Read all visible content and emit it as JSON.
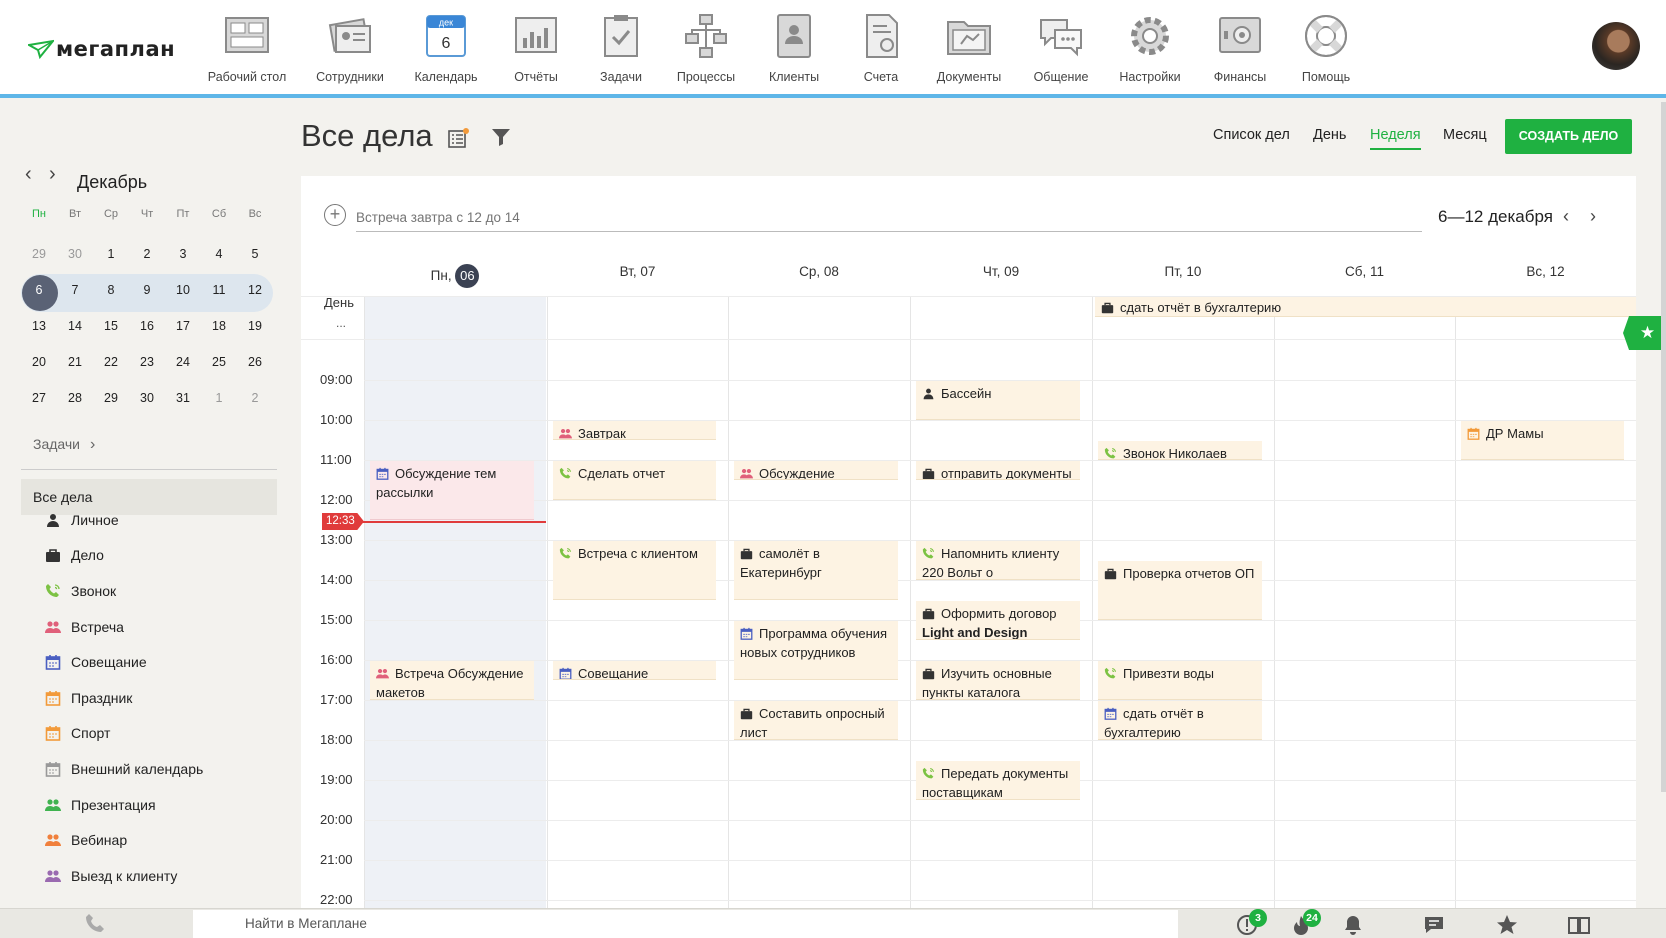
{
  "app": {
    "brand": "мегаплан"
  },
  "nav": [
    {
      "label": "Рабочий стол",
      "icon": "desktop-icon"
    },
    {
      "label": "Сотрудники",
      "icon": "employees-icon"
    },
    {
      "label": "Календарь",
      "icon": "calendar-icon",
      "badge_month": "дек",
      "badge_day": "6"
    },
    {
      "label": "Отчёты",
      "icon": "reports-icon"
    },
    {
      "label": "Задачи",
      "icon": "tasks-icon"
    },
    {
      "label": "Процессы",
      "icon": "processes-icon"
    },
    {
      "label": "Клиенты",
      "icon": "clients-icon"
    },
    {
      "label": "Счета",
      "icon": "invoices-icon"
    },
    {
      "label": "Документы",
      "icon": "documents-icon"
    },
    {
      "label": "Общение",
      "icon": "chat-icon"
    },
    {
      "label": "Настройки",
      "icon": "settings-icon"
    },
    {
      "label": "Финансы",
      "icon": "finance-icon"
    },
    {
      "label": "Помощь",
      "icon": "help-icon"
    }
  ],
  "mini_calendar": {
    "month": "Декабрь",
    "weekdays": [
      "Пн",
      "Вт",
      "Ср",
      "Чт",
      "Пт",
      "Сб",
      "Вс"
    ],
    "weeks": [
      [
        "29",
        "30",
        "1",
        "2",
        "3",
        "4",
        "5"
      ],
      [
        "6",
        "7",
        "8",
        "9",
        "10",
        "11",
        "12"
      ],
      [
        "13",
        "14",
        "15",
        "16",
        "17",
        "18",
        "19"
      ],
      [
        "20",
        "21",
        "22",
        "23",
        "24",
        "25",
        "26"
      ],
      [
        "27",
        "28",
        "29",
        "30",
        "31",
        "1",
        "2"
      ]
    ],
    "today": "6"
  },
  "sidebar": {
    "tasks_link": "Задачи",
    "all_tasks": "Все дела",
    "categories": [
      {
        "label": "Личное",
        "icon": "person-icon",
        "color": "#333333"
      },
      {
        "label": "Дело",
        "icon": "briefcase-icon",
        "color": "#333333"
      },
      {
        "label": "Звонок",
        "icon": "phone-icon",
        "color": "#7cc243"
      },
      {
        "label": "Встреча",
        "icon": "people-icon",
        "color": "#e0607a"
      },
      {
        "label": "Совещание",
        "icon": "calendar-icon",
        "color": "#4a5fc1"
      },
      {
        "label": "Праздник",
        "icon": "calendar-icon",
        "color": "#f29a3a"
      },
      {
        "label": "Спорт",
        "icon": "calendar-icon",
        "color": "#f29a3a"
      },
      {
        "label": "Внешний календарь",
        "icon": "calendar-icon",
        "color": "#999999"
      },
      {
        "label": "Презентация",
        "icon": "people-icon",
        "color": "#3fb34f"
      },
      {
        "label": "Вебинар",
        "icon": "people-icon",
        "color": "#f0803c"
      },
      {
        "label": "Выезд к клиенту",
        "icon": "people-icon",
        "color": "#9a6ab0"
      }
    ]
  },
  "page": {
    "title": "Все дела",
    "views": [
      "Список дел",
      "День",
      "Неделя",
      "Месяц"
    ],
    "active_view": "Неделя",
    "create_button": "СОЗДАТЬ ДЕЛО",
    "quick_placeholder": "Встреча завтра с 12 до 14",
    "range": "6—12 декабря",
    "day_row_label": "День",
    "day_row_more": "...",
    "now_time": "12:33"
  },
  "week": {
    "days": [
      {
        "name": "Пн,",
        "num": "06",
        "today": true
      },
      {
        "name": "Вт, 07"
      },
      {
        "name": "Ср, 08"
      },
      {
        "name": "Чт, 09"
      },
      {
        "name": "Пт, 10"
      },
      {
        "name": "Сб, 11"
      },
      {
        "name": "Вс, 12"
      }
    ],
    "hours": [
      "09:00",
      "10:00",
      "11:00",
      "12:00",
      "13:00",
      "14:00",
      "15:00",
      "16:00",
      "17:00",
      "18:00",
      "19:00",
      "20:00",
      "21:00",
      "22:00"
    ]
  },
  "allday_events": [
    {
      "text": "сдать отчёт в бухгалтерию",
      "icon": "briefcase-icon"
    }
  ],
  "events": [
    {
      "text": "Обсуждение тем рассылки",
      "icon": "calendar-icon",
      "day": 0,
      "start": "11:00",
      "end": "12:30",
      "style": "pink"
    },
    {
      "text": "Встреча  Обсуждение макетов",
      "icon": "people-icon",
      "day": 0,
      "start": "16:00",
      "end": "17:00"
    },
    {
      "text": "Завтрак",
      "icon": "people-icon",
      "day": 1,
      "start": "10:00",
      "end": "10:30"
    },
    {
      "text": "Сделать отчет",
      "icon": "phone-icon",
      "day": 1,
      "start": "11:00",
      "end": "12:00"
    },
    {
      "text": "Встреча с клиентом",
      "icon": "phone-icon",
      "day": 1,
      "start": "13:00",
      "end": "14:30"
    },
    {
      "text": "Совещание  Николаев",
      "icon": "calendar-icon",
      "day": 1,
      "start": "16:00",
      "end": "16:30"
    },
    {
      "text": "Обсуждение",
      "icon": "people-icon",
      "day": 2,
      "start": "11:00",
      "end": "11:30"
    },
    {
      "text": "самолёт в Екатеринбург",
      "icon": "briefcase-icon",
      "day": 2,
      "start": "13:00",
      "end": "14:30"
    },
    {
      "text": "Программа обучения новых сотрудников",
      "icon": "calendar-icon",
      "day": 2,
      "start": "15:00",
      "end": "16:30"
    },
    {
      "text": "Составить опросный лист",
      "icon": "briefcase-icon",
      "day": 2,
      "start": "17:00",
      "end": "18:00"
    },
    {
      "text": "Бассейн",
      "icon": "person-icon",
      "day": 3,
      "start": "09:00",
      "end": "10:00"
    },
    {
      "text": "отправить документы",
      "icon": "briefcase-icon",
      "day": 3,
      "start": "11:00",
      "end": "11:30"
    },
    {
      "text": "Напомнить клиенту 220 Вольт о",
      "icon": "phone-icon",
      "day": 3,
      "start": "13:00",
      "end": "14:00"
    },
    {
      "text": "Оформить договор ",
      "bold": "Light and Design",
      "icon": "briefcase-icon",
      "day": 3,
      "start": "14:30",
      "end": "15:30"
    },
    {
      "text": "Изучить основные пункты каталога",
      "icon": "briefcase-icon",
      "day": 3,
      "start": "16:00",
      "end": "17:00"
    },
    {
      "text": "Передать документы поставщикам",
      "icon": "phone-icon",
      "day": 3,
      "start": "18:30",
      "end": "19:30"
    },
    {
      "text": "Звонок  Николаев",
      "icon": "phone-icon",
      "day": 4,
      "start": "10:30",
      "end": "11:00"
    },
    {
      "text": "Проверка отчетов ОП",
      "icon": "briefcase-icon",
      "day": 4,
      "start": "13:30",
      "end": "15:00"
    },
    {
      "text": "Привезти воды",
      "icon": "phone-icon",
      "day": 4,
      "start": "16:00",
      "end": "17:00"
    },
    {
      "text": "сдать отчёт в бухгалтерию",
      "icon": "calendar-icon",
      "day": 4,
      "start": "17:00",
      "end": "18:00"
    },
    {
      "text": "ДР Мамы",
      "icon": "calendar-icon",
      "day": 6,
      "start": "10:00",
      "end": "11:00"
    }
  ],
  "bottom": {
    "search_placeholder": "Найти в Мегаплане",
    "alerts_count": "3",
    "hot_count": "24"
  },
  "colors": {
    "accent": "#1fb141",
    "topline": "#5eb6e8",
    "now": "#e03b3b"
  }
}
